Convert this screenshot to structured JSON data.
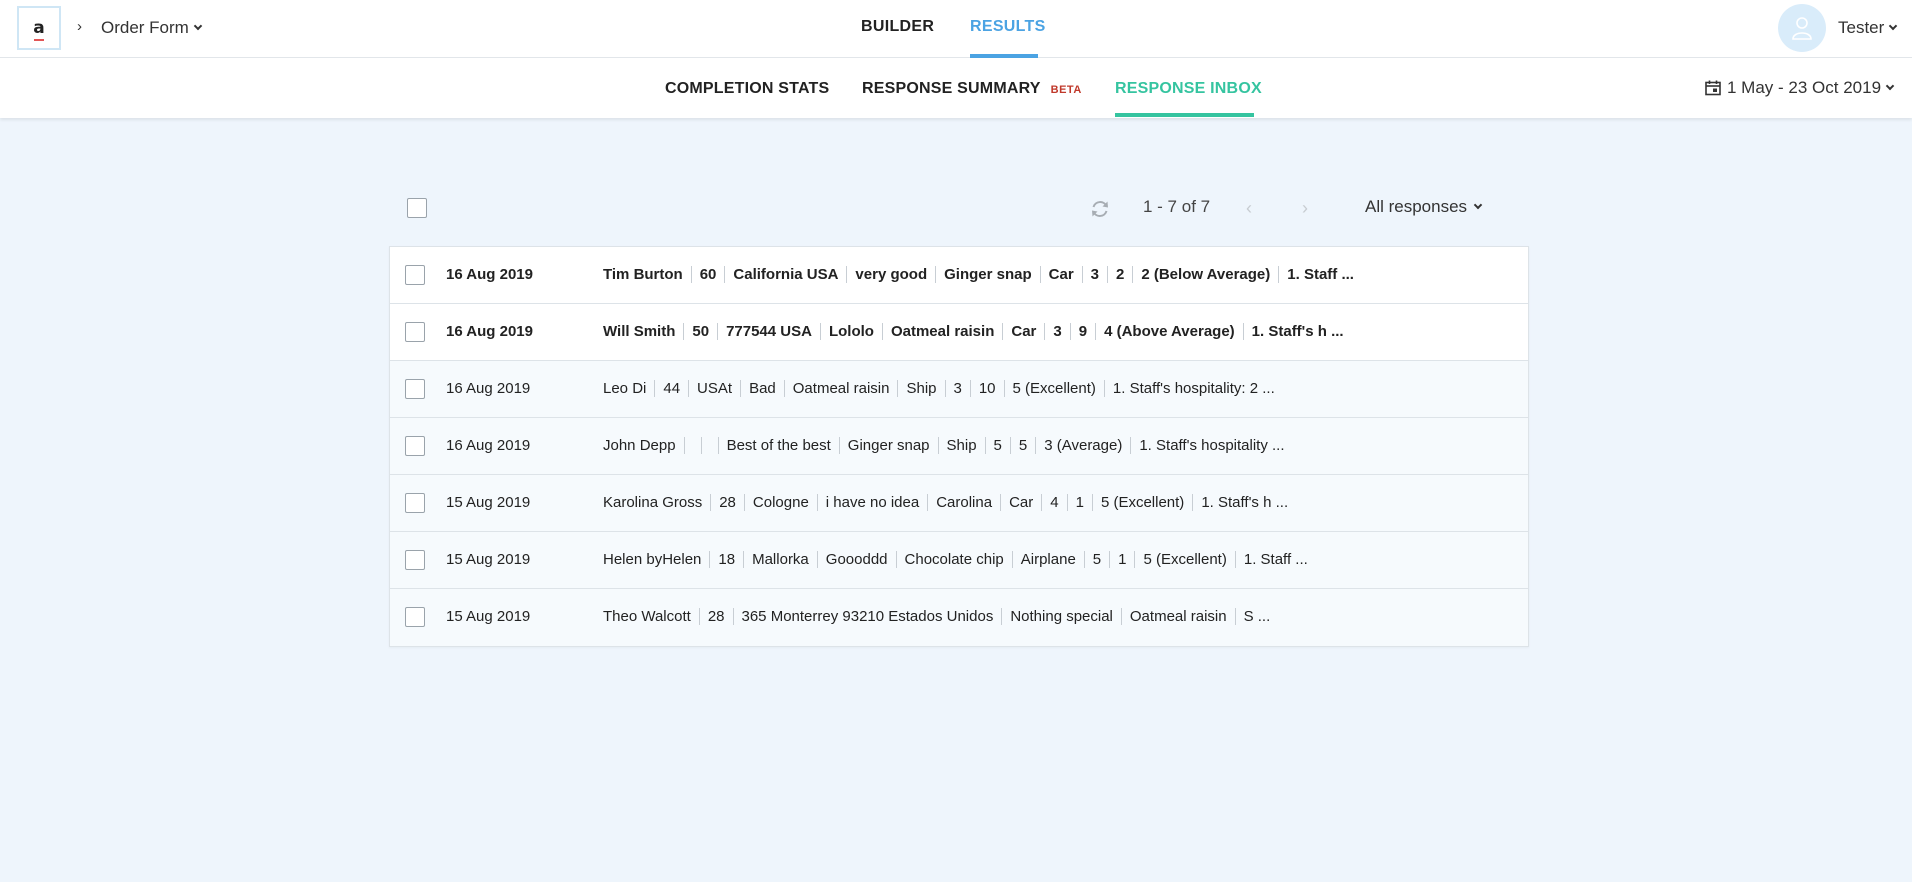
{
  "header": {
    "form_name": "Order Form",
    "tabs": [
      "BUILDER",
      "RESULTS"
    ],
    "user": "Tester"
  },
  "subnav": {
    "tabs": [
      "COMPLETION STATS",
      "RESPONSE SUMMARY",
      "RESPONSE INBOX"
    ],
    "beta": "BETA",
    "date_range": "1 May - 23 Oct 2019"
  },
  "toolbar": {
    "page_info": "1 - 7 of 7",
    "filter": "All responses"
  },
  "accent_colors": {
    "results": "#4ba3e3",
    "inbox": "#35c4a0",
    "beta": "#c0392b"
  },
  "responses": [
    {
      "date": "16 Aug 2019",
      "unread": true,
      "fields": [
        "Tim Burton",
        "60",
        "California USA",
        "very good",
        "Ginger snap",
        "Car",
        "3",
        "2",
        "2 (Below Average)",
        "1. Staff ..."
      ]
    },
    {
      "date": "16 Aug 2019",
      "unread": true,
      "fields": [
        "Will Smith",
        "50",
        "777544 USA",
        "Lololo",
        "Oatmeal raisin",
        "Car",
        "3",
        "9",
        "4 (Above Average)",
        "1. Staff's h ..."
      ]
    },
    {
      "date": "16 Aug 2019",
      "unread": false,
      "fields": [
        "Leo Di",
        "44",
        "USAt",
        "Bad",
        "Oatmeal raisin",
        "Ship",
        "3",
        "10",
        "5 (Excellent)",
        "1. Staff's hospitality: 2  ..."
      ]
    },
    {
      "date": "16 Aug 2019",
      "unread": false,
      "fields": [
        "John Depp",
        "",
        "",
        "Best of the best",
        "Ginger snap",
        "Ship",
        "5",
        "5",
        "3 (Average)",
        "1. Staff's hospitality ..."
      ]
    },
    {
      "date": "15 Aug 2019",
      "unread": false,
      "fields": [
        "Karolina Gross",
        "28",
        "Cologne",
        "i have no idea",
        "Carolina",
        "Car",
        "4",
        "1",
        "5 (Excellent)",
        "1. Staff's h ..."
      ]
    },
    {
      "date": "15 Aug 2019",
      "unread": false,
      "fields": [
        "Helen byHelen",
        "18",
        "Mallorka",
        "Goooddd",
        "Chocolate chip",
        "Airplane",
        "5",
        "1",
        "5 (Excellent)",
        "1. Staff ..."
      ]
    },
    {
      "date": "15 Aug 2019",
      "unread": false,
      "fields": [
        "Theo Walcott",
        "28",
        "365 Monterrey 93210 Estados Unidos",
        "Nothing special",
        "Oatmeal raisin",
        "S ..."
      ]
    }
  ]
}
